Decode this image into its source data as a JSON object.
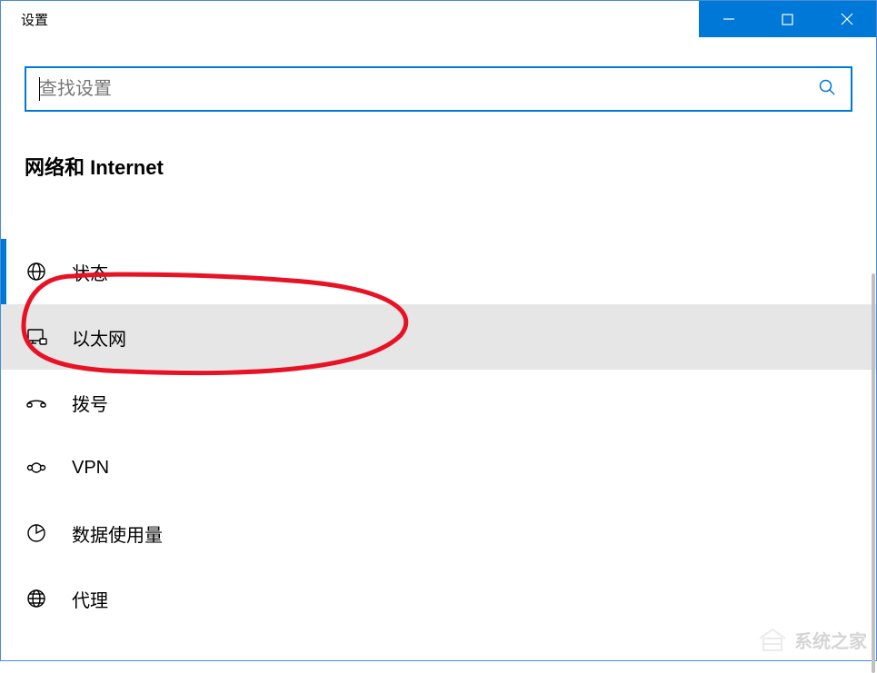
{
  "window": {
    "title": "设置"
  },
  "search": {
    "placeholder": "查找设置"
  },
  "section": {
    "heading": "网络和 Internet"
  },
  "nav": {
    "items": [
      {
        "icon": "status-icon",
        "label": "状态",
        "active": true,
        "selected": false
      },
      {
        "icon": "ethernet-icon",
        "label": "以太网",
        "active": false,
        "selected": true
      },
      {
        "icon": "dialup-icon",
        "label": "拨号",
        "active": false,
        "selected": false
      },
      {
        "icon": "vpn-icon",
        "label": "VPN",
        "active": false,
        "selected": false
      },
      {
        "icon": "data-usage-icon",
        "label": "数据使用量",
        "active": false,
        "selected": false
      },
      {
        "icon": "proxy-icon",
        "label": "代理",
        "active": false,
        "selected": false
      }
    ]
  },
  "watermark": {
    "text": "系统之家"
  },
  "annotation": {
    "color": "#e81225"
  }
}
